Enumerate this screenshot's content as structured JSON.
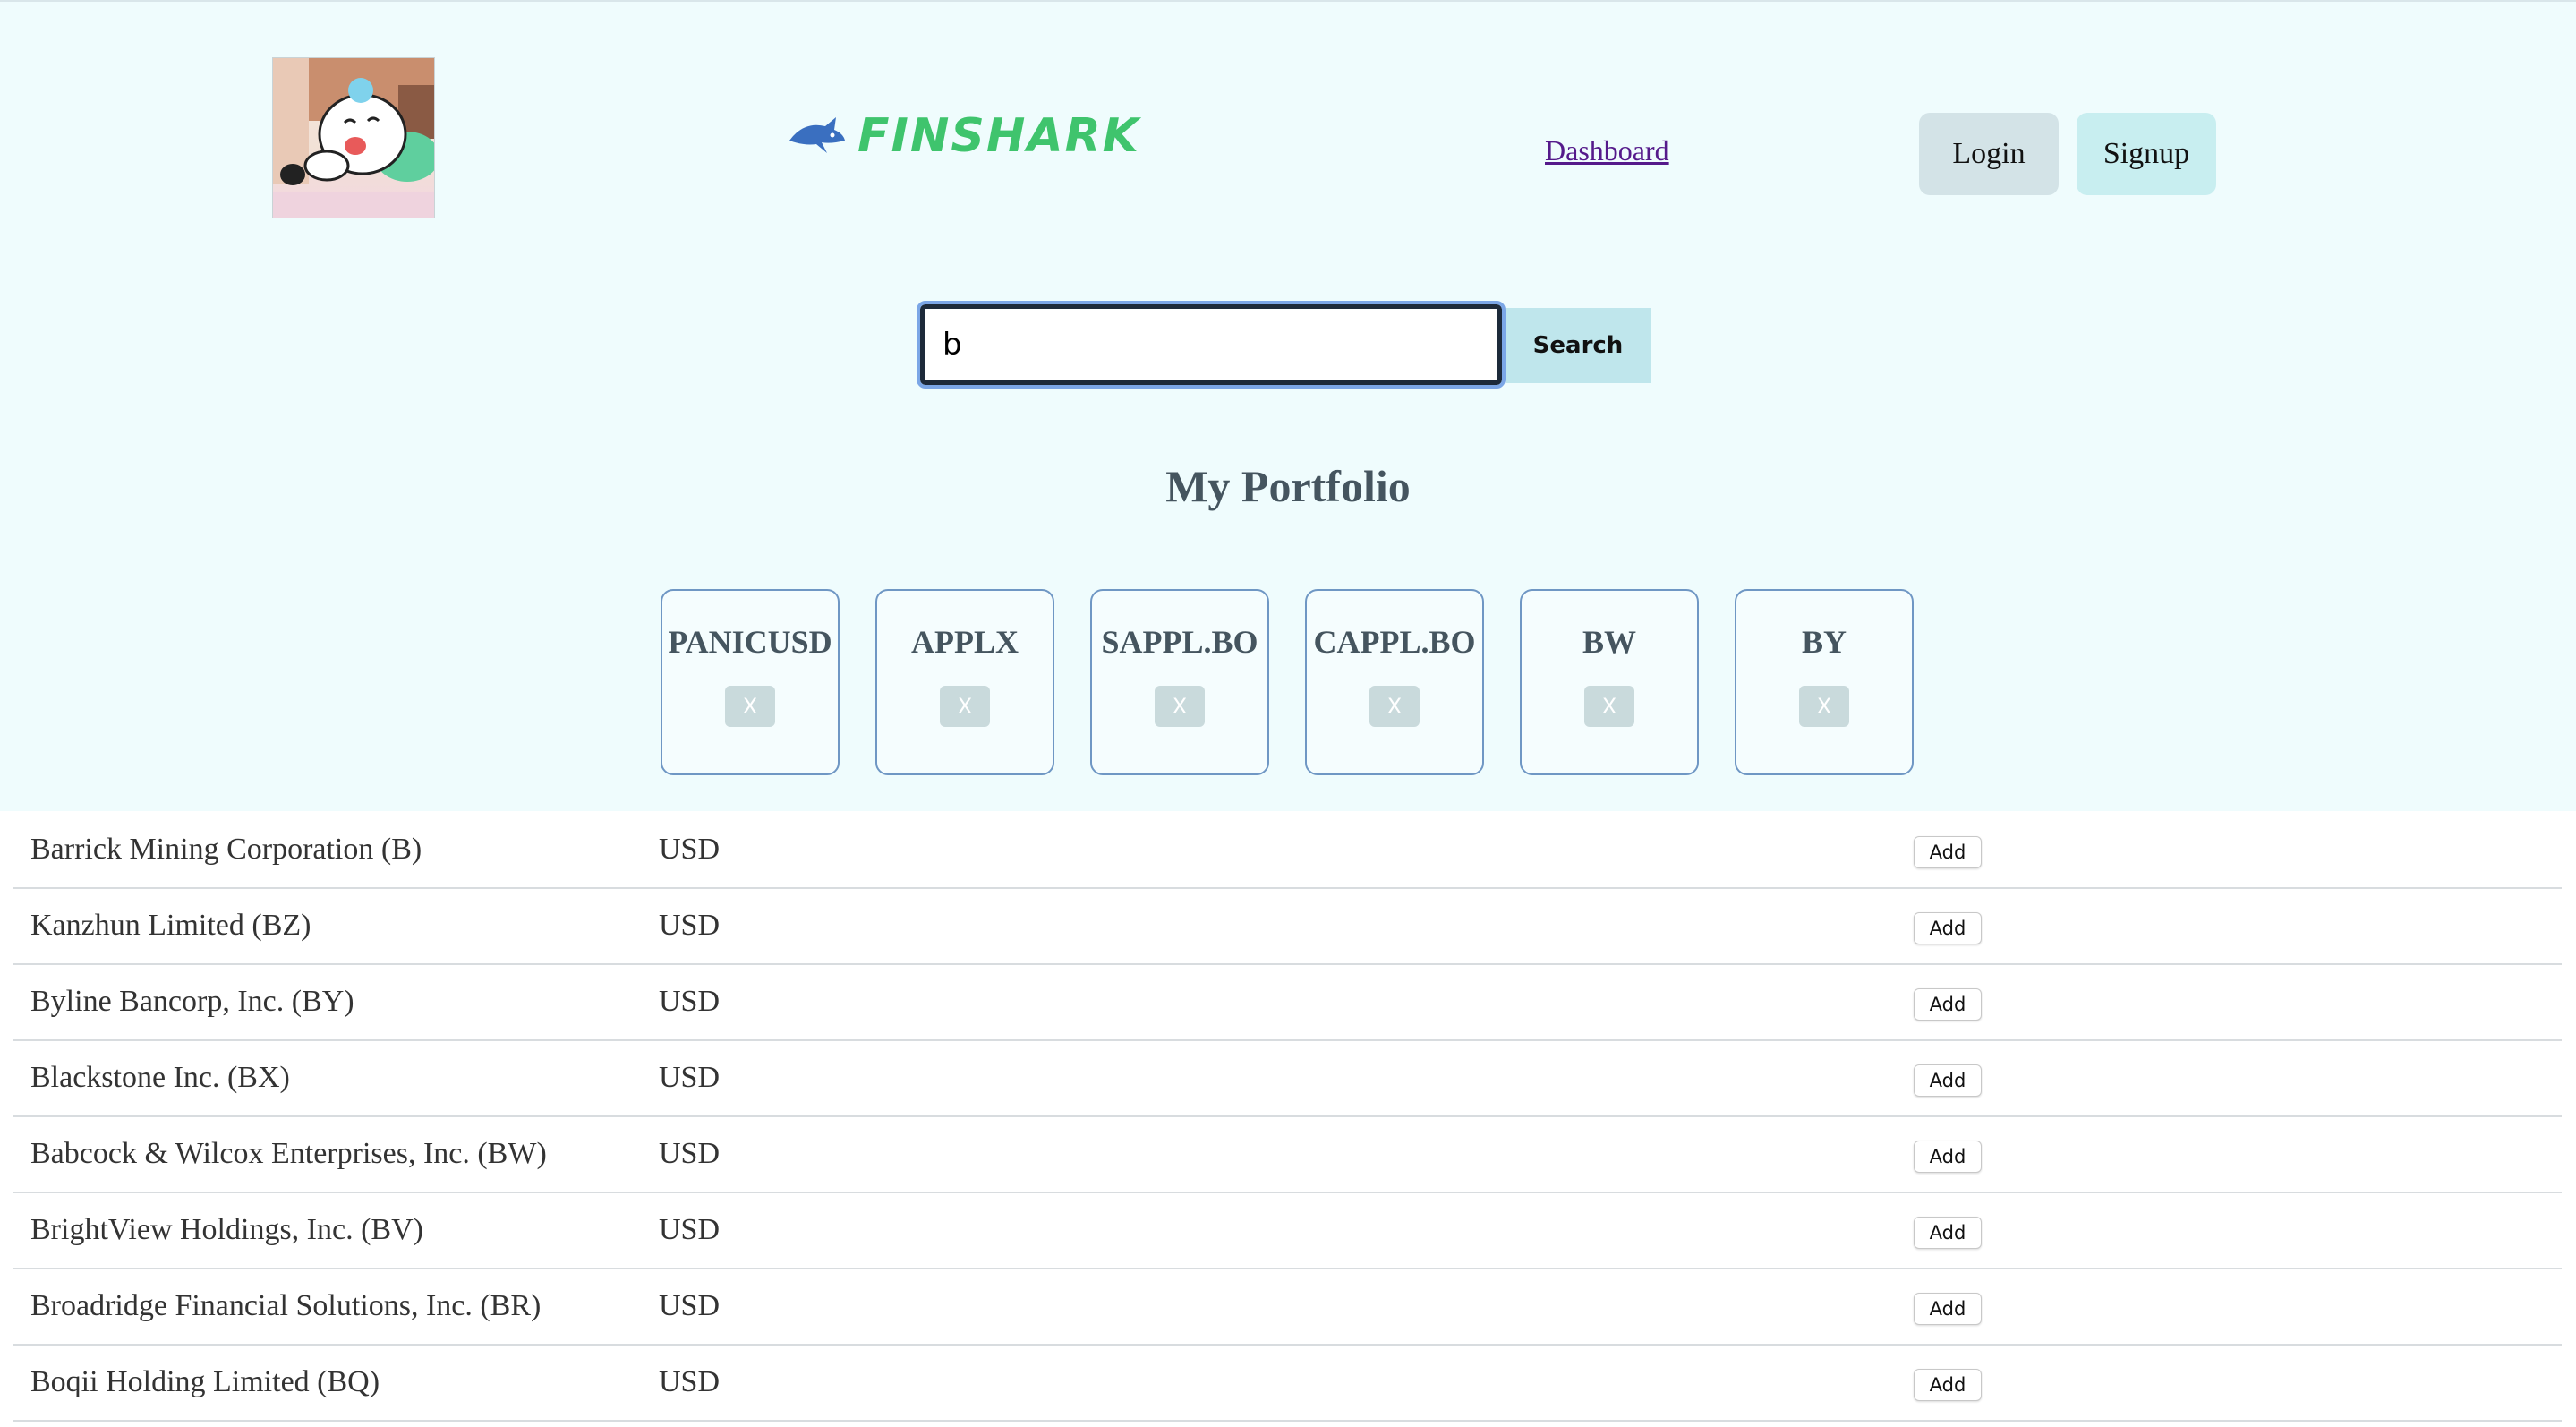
{
  "header": {
    "logo_text": "FINSHARK",
    "nav_dashboard": "Dashboard",
    "login_label": "Login",
    "signup_label": "Signup"
  },
  "search": {
    "value": "b",
    "button_label": "Search"
  },
  "portfolio": {
    "title": "My Portfolio",
    "items": [
      {
        "symbol": "PANICUSD",
        "remove_label": "X"
      },
      {
        "symbol": "APPLX",
        "remove_label": "X"
      },
      {
        "symbol": "SAPPL.BO",
        "remove_label": "X"
      },
      {
        "symbol": "CAPPL.BO",
        "remove_label": "X"
      },
      {
        "symbol": "BW",
        "remove_label": "X"
      },
      {
        "symbol": "BY",
        "remove_label": "X"
      }
    ]
  },
  "results": [
    {
      "name": "Barrick Mining Corporation (B)",
      "currency": "USD",
      "action": "Add"
    },
    {
      "name": "Kanzhun Limited (BZ)",
      "currency": "USD",
      "action": "Add"
    },
    {
      "name": "Byline Bancorp, Inc. (BY)",
      "currency": "USD",
      "action": "Add"
    },
    {
      "name": "Blackstone Inc. (BX)",
      "currency": "USD",
      "action": "Add"
    },
    {
      "name": "Babcock & Wilcox Enterprises, Inc. (BW)",
      "currency": "USD",
      "action": "Add"
    },
    {
      "name": "BrightView Holdings, Inc. (BV)",
      "currency": "USD",
      "action": "Add"
    },
    {
      "name": "Broadridge Financial Solutions, Inc. (BR)",
      "currency": "USD",
      "action": "Add"
    },
    {
      "name": "Boqii Holding Limited (BQ)",
      "currency": "USD",
      "action": "Add"
    }
  ],
  "colors": {
    "background": "#effcfd",
    "logo_green": "#3fc46d",
    "logo_blue": "#3a6fc0",
    "card_border": "#6f97c4"
  }
}
